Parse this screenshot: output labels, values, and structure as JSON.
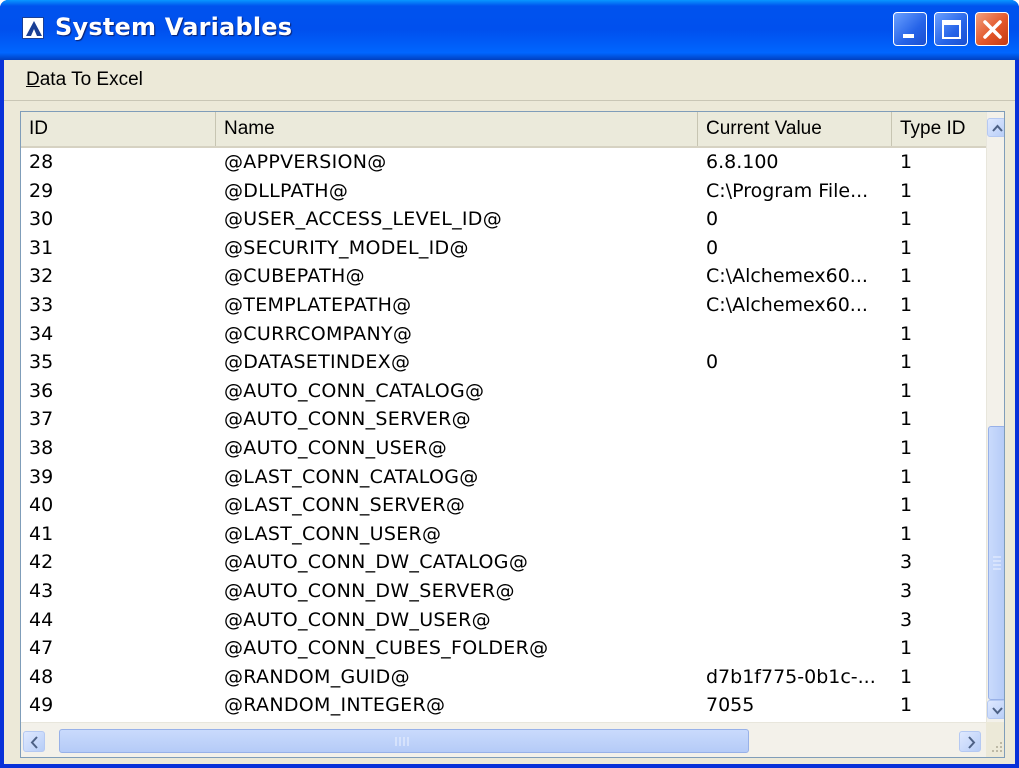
{
  "window": {
    "title": "System Variables"
  },
  "menu": {
    "items": [
      {
        "label": "Data To Excel",
        "accel": "D",
        "rest": "ata To Excel"
      }
    ]
  },
  "table": {
    "columns": [
      "ID",
      "Name",
      "Current Value",
      "Type ID"
    ],
    "rows": [
      [
        "28",
        "@APPVERSION@",
        "6.8.100",
        "1"
      ],
      [
        "29",
        "@DLLPATH@",
        "C:\\Program File...",
        "1"
      ],
      [
        "30",
        "@USER_ACCESS_LEVEL_ID@",
        "0",
        "1"
      ],
      [
        "31",
        "@SECURITY_MODEL_ID@",
        "0",
        "1"
      ],
      [
        "32",
        "@CUBEPATH@",
        "C:\\Alchemex60...",
        "1"
      ],
      [
        "33",
        "@TEMPLATEPATH@",
        "C:\\Alchemex60...",
        "1"
      ],
      [
        "34",
        "@CURRCOMPANY@",
        "",
        "1"
      ],
      [
        "35",
        "@DATASETINDEX@",
        "0",
        "1"
      ],
      [
        "36",
        "@AUTO_CONN_CATALOG@",
        "",
        "1"
      ],
      [
        "37",
        "@AUTO_CONN_SERVER@",
        "",
        "1"
      ],
      [
        "38",
        "@AUTO_CONN_USER@",
        "",
        "1"
      ],
      [
        "39",
        "@LAST_CONN_CATALOG@",
        "",
        "1"
      ],
      [
        "40",
        "@LAST_CONN_SERVER@",
        "",
        "1"
      ],
      [
        "41",
        "@LAST_CONN_USER@",
        "",
        "1"
      ],
      [
        "42",
        "@AUTO_CONN_DW_CATALOG@",
        "",
        "3"
      ],
      [
        "43",
        "@AUTO_CONN_DW_SERVER@",
        "",
        "3"
      ],
      [
        "44",
        "@AUTO_CONN_DW_USER@",
        "",
        "3"
      ],
      [
        "47",
        "@AUTO_CONN_CUBES_FOLDER@",
        "",
        "1"
      ],
      [
        "48",
        "@RANDOM_GUID@",
        "d7b1f775-0b1c-...",
        "1"
      ],
      [
        "49",
        "@RANDOM_INTEGER@",
        "7055",
        "1"
      ]
    ]
  },
  "icons": {
    "app": "app-logo-icon",
    "minimize": "minimize-icon",
    "maximize": "maximize-icon",
    "close": "close-icon",
    "scroll_up": "chevron-up-icon",
    "scroll_down": "chevron-down-icon",
    "scroll_left": "chevron-left-icon",
    "scroll_right": "chevron-right-icon",
    "grip": "resize-grip-icon"
  },
  "colors": {
    "titlebar": "#0053ee",
    "close_button": "#e3572a",
    "face": "#ece9d8"
  }
}
